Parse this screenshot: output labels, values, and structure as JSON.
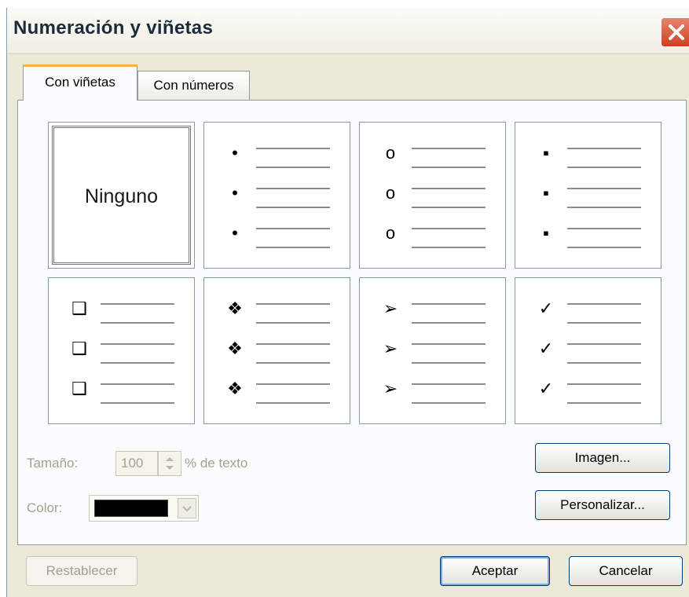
{
  "window": {
    "title": "Numeración y viñetas"
  },
  "tabs": [
    {
      "label": "Con viñetas",
      "active": true
    },
    {
      "label": "Con números",
      "active": false
    }
  ],
  "gallery": {
    "none_label": "Ninguno",
    "bullets": [
      "•",
      "o",
      "▪",
      "❑",
      "❖",
      "➢",
      "✓"
    ],
    "selected": "Ninguno"
  },
  "size": {
    "label": "Tamaño:",
    "value": "100",
    "unit": "% de texto"
  },
  "color": {
    "label": "Color:",
    "value": "#000000"
  },
  "buttons": {
    "image": "Imagen...",
    "customize": "Personalizar...",
    "reset": "Restablecer",
    "ok": "Aceptar",
    "cancel": "Cancelar"
  }
}
